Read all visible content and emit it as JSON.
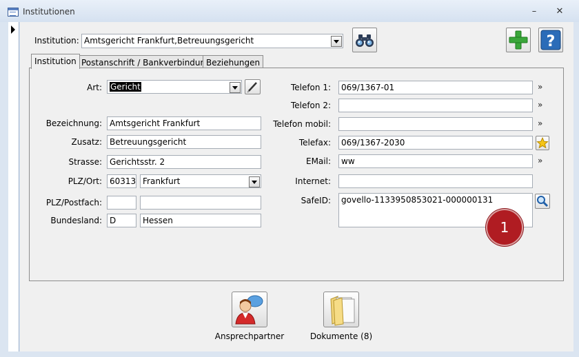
{
  "window": {
    "title": "Institutionen"
  },
  "window_buttons": {
    "minimize": "–",
    "close": "✕"
  },
  "top": {
    "institution_label": "Institution:",
    "institution_value": "Amtsgericht Frankfurt,Betreuungsgericht"
  },
  "icons": {
    "search": "binoculars-icon",
    "add": "plus-icon",
    "help": "help-icon",
    "edit": "pencil-icon",
    "favorite": "star-icon",
    "safeid_lookup": "magnifier-icon",
    "contacts": "person-chat-icon",
    "documents": "folder-icon"
  },
  "tabs": [
    {
      "label": "Institution",
      "active": true
    },
    {
      "label": "Postanschrift / Bankverbindung",
      "active": false
    },
    {
      "label": "Beziehungen",
      "active": false
    }
  ],
  "left_fields": {
    "art": {
      "label": "Art:",
      "value": "Gericht"
    },
    "bezeichnung": {
      "label": "Bezeichnung:",
      "value": "Amtsgericht Frankfurt"
    },
    "zusatz": {
      "label": "Zusatz:",
      "value": "Betreuungsgericht"
    },
    "strasse": {
      "label": "Strasse:",
      "value": "Gerichtsstr. 2"
    },
    "plz_ort": {
      "label": "PLZ/Ort:",
      "plz": "60313",
      "ort": "Frankfurt"
    },
    "plz_postfach": {
      "label": "PLZ/Postfach:",
      "plz": "",
      "postfach": ""
    },
    "bundesland": {
      "label": "Bundesland:",
      "code": "D",
      "name": "Hessen"
    }
  },
  "right_fields": {
    "telefon1": {
      "label": "Telefon 1:",
      "value": "069/1367-01"
    },
    "telefon2": {
      "label": "Telefon 2:",
      "value": ""
    },
    "telefon_mobil": {
      "label": "Telefon mobil:",
      "value": ""
    },
    "telefax": {
      "label": "Telefax:",
      "value": "069/1367-2030"
    },
    "email": {
      "label": "EMail:",
      "value": "ww"
    },
    "internet": {
      "label": "Internet:",
      "value": ""
    },
    "safeid": {
      "label": "SafeID:",
      "value": "govello-1133950853021-000000131"
    }
  },
  "chevron": "»",
  "badge": {
    "number": "1",
    "color": "#b01c22"
  },
  "bottom": {
    "contacts_label": "Ansprechpartner",
    "documents_label": "Dokumente (8)"
  }
}
